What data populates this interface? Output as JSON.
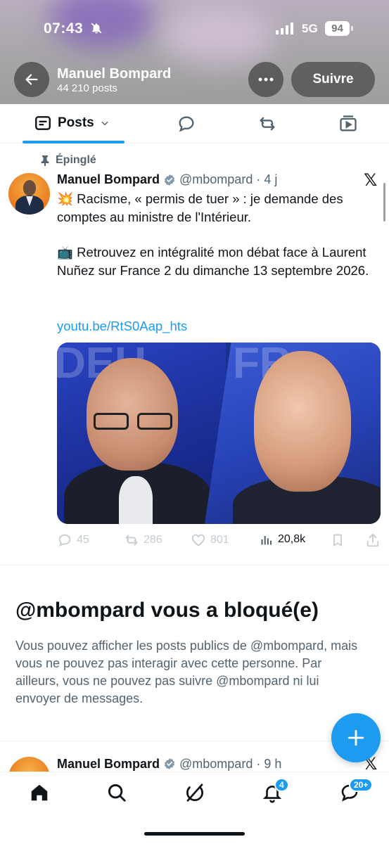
{
  "status_bar": {
    "time": "07:43",
    "network": "5G",
    "battery": "94"
  },
  "header": {
    "name": "Manuel Bompard",
    "post_count": "44 210 posts",
    "follow_label": "Suivre",
    "more_icon": "more-horizontal-icon",
    "back_icon": "arrow-left-icon"
  },
  "tabs": [
    {
      "label": "Posts",
      "icon": "document-icon",
      "active": true
    },
    {
      "icon": "reply-bubble-icon"
    },
    {
      "icon": "repost-icon"
    },
    {
      "icon": "media-icon"
    }
  ],
  "pinned_post": {
    "pinned_label": "Épinglé",
    "author": "Manuel Bompard",
    "handle": "@mbompard",
    "time": "· 4 j",
    "lines1": "💥 Racisme, « permis de tuer » : je demande des comptes au ministre de l'Intérieur.",
    "lines2": "📺 Retrouvez en intégralité mon débat face à Laurent Nuñez sur France 2 du dimanche 13 septembre 2026.",
    "link": "youtu.be/RtS0Aap_hts",
    "media_text_left": "DEU",
    "media_text_right": "FR",
    "stats": {
      "replies": "45",
      "reposts": "286",
      "likes": "801",
      "views": "20,8k"
    }
  },
  "blocked": {
    "title": "@mbompard vous a bloqué(e)",
    "body": "Vous pouvez afficher les posts publics de @mbompard, mais vous ne pouvez pas interagir avec cette personne. Par ailleurs, vous ne pouvez pas suivre @mbompard ni lui envoyer de messages."
  },
  "next_post": {
    "author": "Manuel Bompard",
    "handle": "@mbompard",
    "time": "· 9 h"
  },
  "bottom_nav": {
    "notifications_badge": "4",
    "messages_badge": "20+"
  },
  "colors": {
    "accent": "#1d9bf0",
    "text": "#0f1419",
    "secondary": "#536471"
  }
}
